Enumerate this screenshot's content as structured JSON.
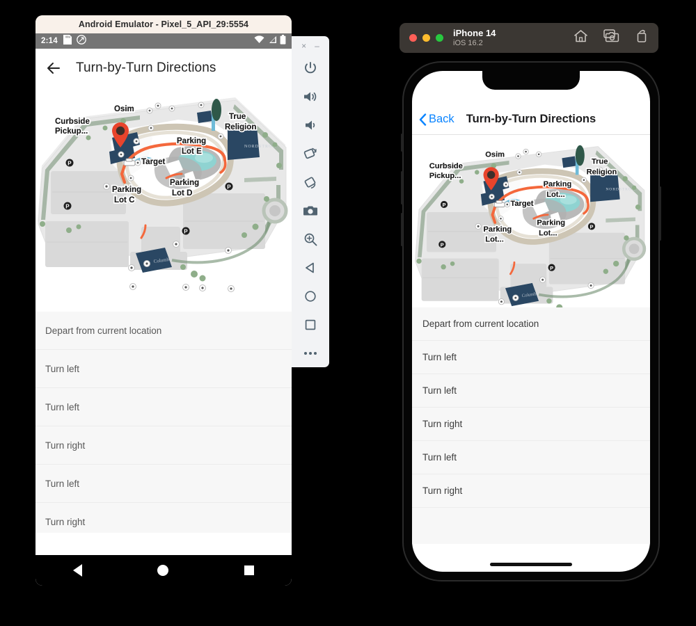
{
  "android": {
    "window_title": "Android Emulator - Pixel_5_API_29:5554",
    "status_bar": {
      "time": "2:14",
      "icons": [
        "sd-card-icon",
        "location-icon",
        "wifi-icon",
        "signal-icon",
        "battery-icon"
      ]
    },
    "app_bar": {
      "back_icon": "back-arrow-icon",
      "title": "Turn-by-Turn Directions"
    },
    "directions": [
      "Depart from current location",
      "Turn left",
      "Turn left",
      "Turn right",
      "Turn left",
      "Turn right"
    ],
    "nav_bar": [
      "back-triangle-icon",
      "home-circle-icon",
      "overview-square-icon"
    ],
    "map_labels": [
      "Osim",
      "Curbside Pickup...",
      "True Religion",
      "NORDSTROM",
      "Parking Lot E",
      "Target",
      "Parking Lot D",
      "Parking Lot C",
      "Columbia"
    ]
  },
  "emulator_toolbar": {
    "close_label": "×",
    "minimize_label": "–",
    "buttons": [
      "power-icon",
      "volume-up-icon",
      "volume-down-icon",
      "rotate-left-icon",
      "rotate-right-icon",
      "camera-icon",
      "zoom-icon",
      "back-icon",
      "home-icon",
      "overview-icon",
      "more-icon"
    ]
  },
  "ios": {
    "window": {
      "device_name": "iPhone 14",
      "os_version": "iOS 16.2",
      "icons": [
        "home-icon",
        "screenshot-icon",
        "rotate-icon"
      ],
      "traffic_lights": [
        "#ff5f57",
        "#febc2e",
        "#28c840"
      ]
    },
    "nav_bar": {
      "back_label": "Back",
      "title": "Turn-by-Turn Directions",
      "tint_color": "#0a84ff"
    },
    "directions": [
      "Depart from current location",
      "Turn left",
      "Turn left",
      "Turn right",
      "Turn left",
      "Turn right"
    ],
    "map_labels": [
      "Osim",
      "Curbside Pickup...",
      "True Religion",
      "NORDSTROM",
      "Parking Lot...",
      "Target",
      "Parking Lot...",
      "Parking Lot...",
      "Columbia"
    ]
  },
  "colors": {
    "route": "#f4683c",
    "pin": "#e8442c",
    "map_ground": "#e9e9e9",
    "map_building": "#2a4763",
    "map_green": "#6f8d6f",
    "map_water": "#8fd3d1",
    "android_status_bg": "#757575",
    "android_title_bg": "#f9f1ea",
    "ios_window_bg": "#3b3733"
  }
}
